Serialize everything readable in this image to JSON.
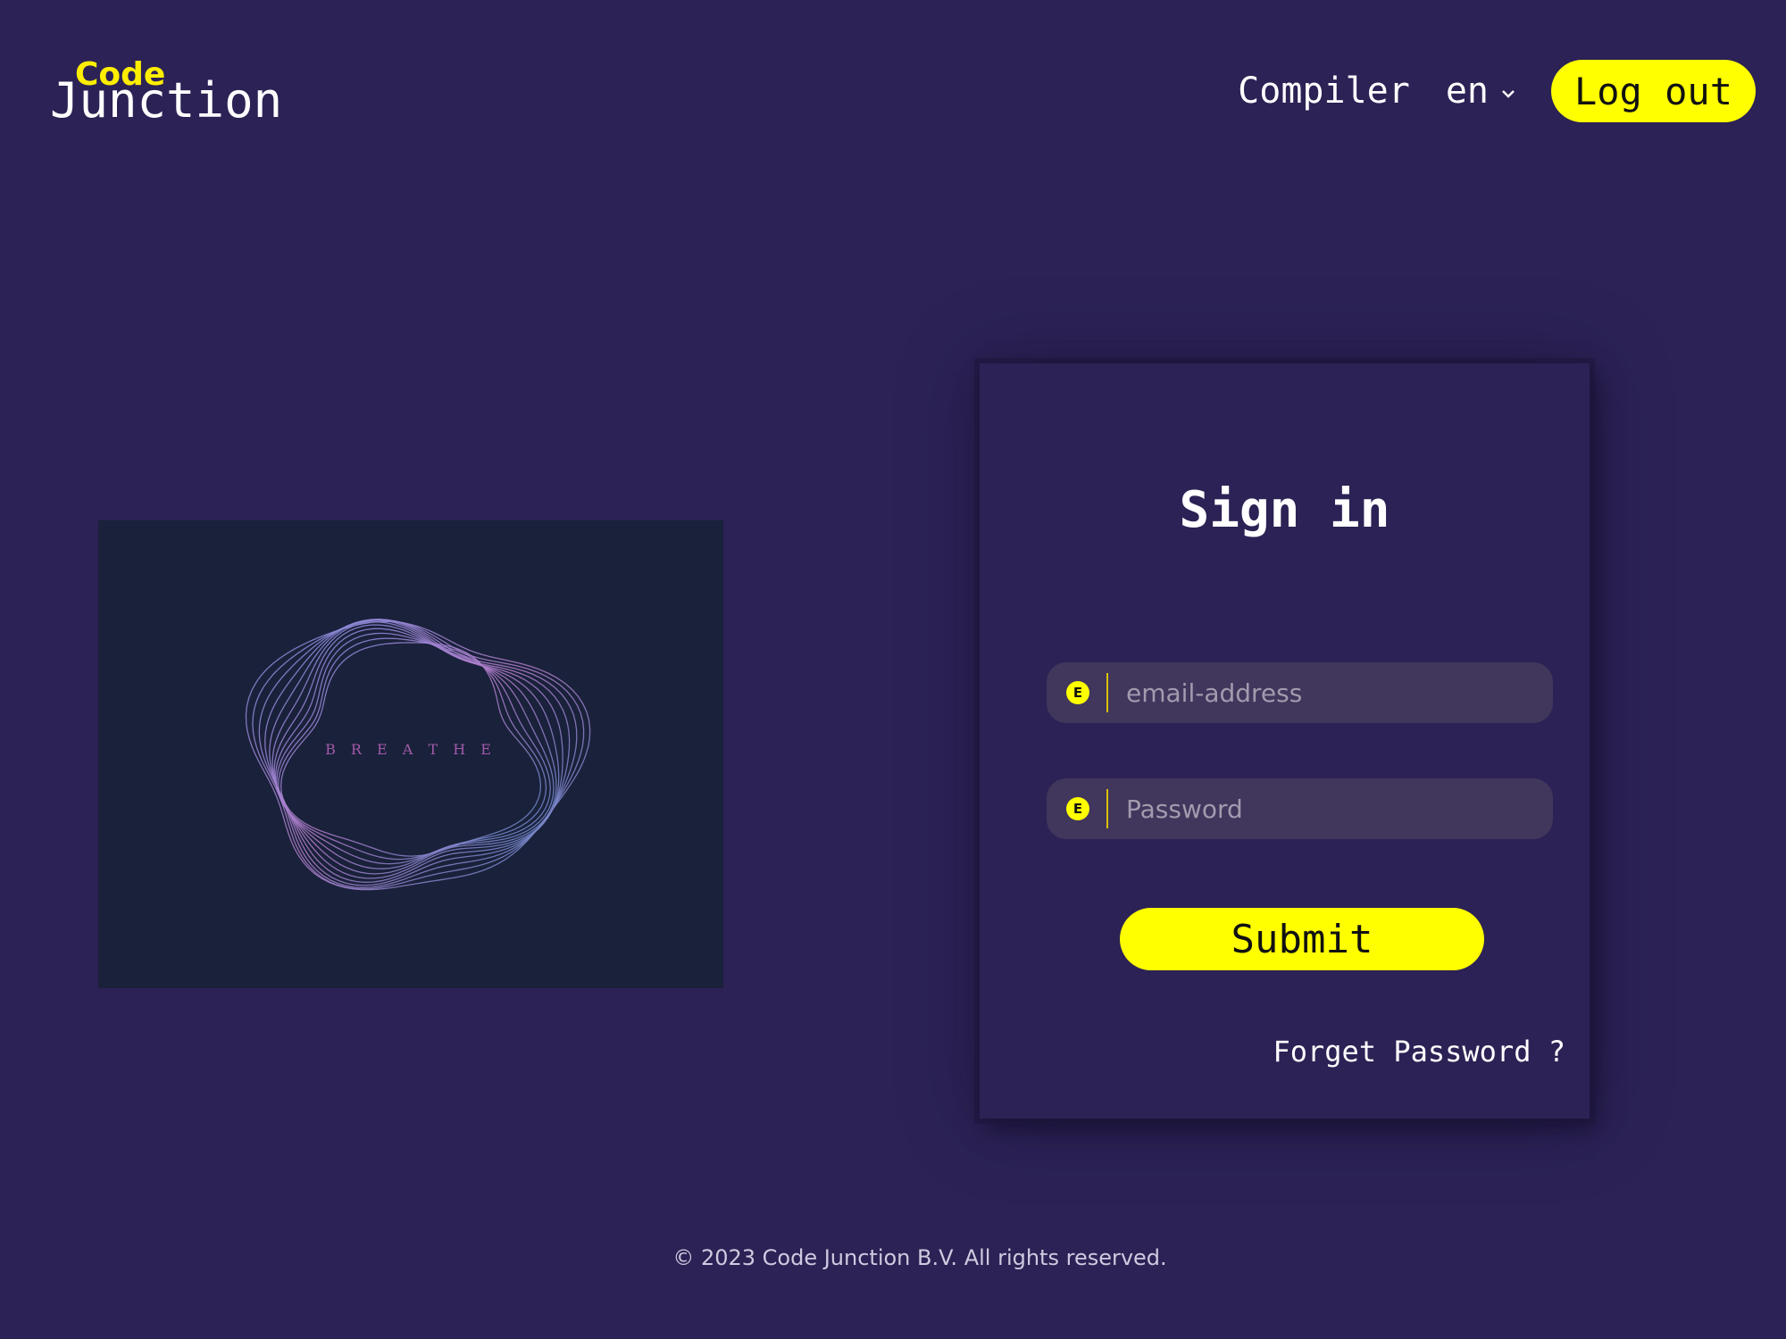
{
  "header": {
    "logo_top": "Code",
    "logo_bottom": "Junction",
    "nav_compiler": "Compiler",
    "language": "en",
    "logout_label": "Log out"
  },
  "illustration": {
    "text": "B R E A T H E"
  },
  "signin": {
    "title": "Sign in",
    "email_placeholder": "email-address",
    "email_icon": "E",
    "password_placeholder": "Password",
    "password_icon": "E",
    "submit_label": "Submit",
    "forgot_label": "Forget Password ?"
  },
  "footer": {
    "text": "© 2023 Code Junction B.V. All rights reserved."
  },
  "colors": {
    "background": "#2c2255",
    "accent": "#ffff00",
    "illustration_bg": "#1a213a",
    "field_bg": "#41365c"
  }
}
